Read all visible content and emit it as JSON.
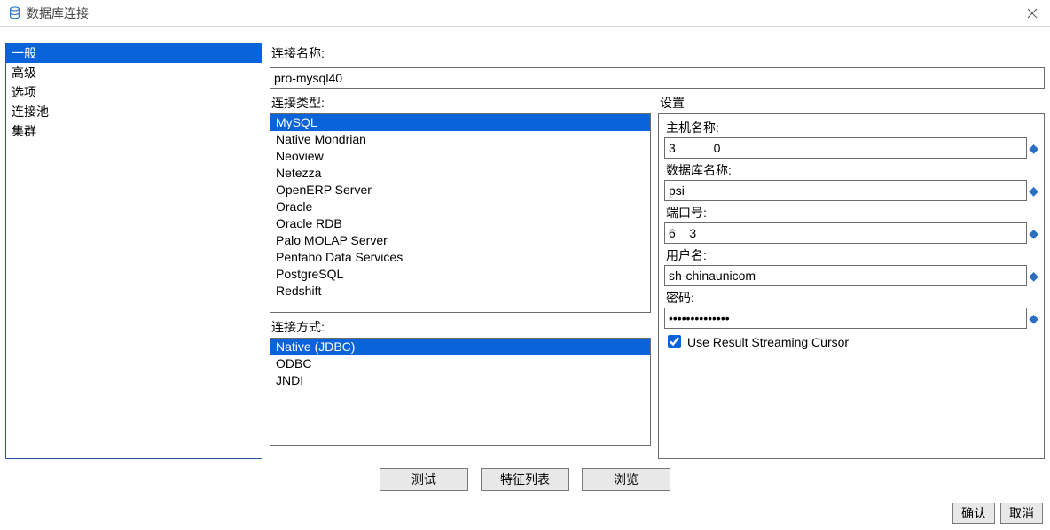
{
  "window": {
    "title": "数据库连接"
  },
  "sidebar": {
    "items": [
      "一般",
      "高级",
      "选项",
      "连接池",
      "集群"
    ],
    "selected_index": 0
  },
  "labels": {
    "connection_name": "连接名称:",
    "connection_type": "连接类型:",
    "access": "连接方式:",
    "settings": "设置",
    "host": "主机名称:",
    "db_name": "数据库名称:",
    "port": "端口号:",
    "user": "用户名:",
    "password": "密码:"
  },
  "connection_name": "pro-mysql40",
  "connection_types": [
    "MySQL",
    "Native Mondrian",
    "Neoview",
    "Netezza",
    "OpenERP Server",
    "Oracle",
    "Oracle RDB",
    "Palo MOLAP Server",
    "Pentaho Data Services",
    "PostgreSQL",
    "Redshift"
  ],
  "connection_type_selected_index": 0,
  "access_methods": [
    "Native (JDBC)",
    "ODBC",
    "JNDI"
  ],
  "access_selected_index": 0,
  "settings": {
    "host": "3           0",
    "db_name": "psi",
    "port": "6    3",
    "user": "sh-chinaunicom",
    "password": "••••••••••••••",
    "use_result_streaming_cursor_label": "Use Result Streaming Cursor",
    "use_result_streaming_cursor_checked": true
  },
  "buttons": {
    "test": "测试",
    "feature_list": "特征列表",
    "browse": "浏览",
    "ok": "确认",
    "cancel": "取消"
  }
}
